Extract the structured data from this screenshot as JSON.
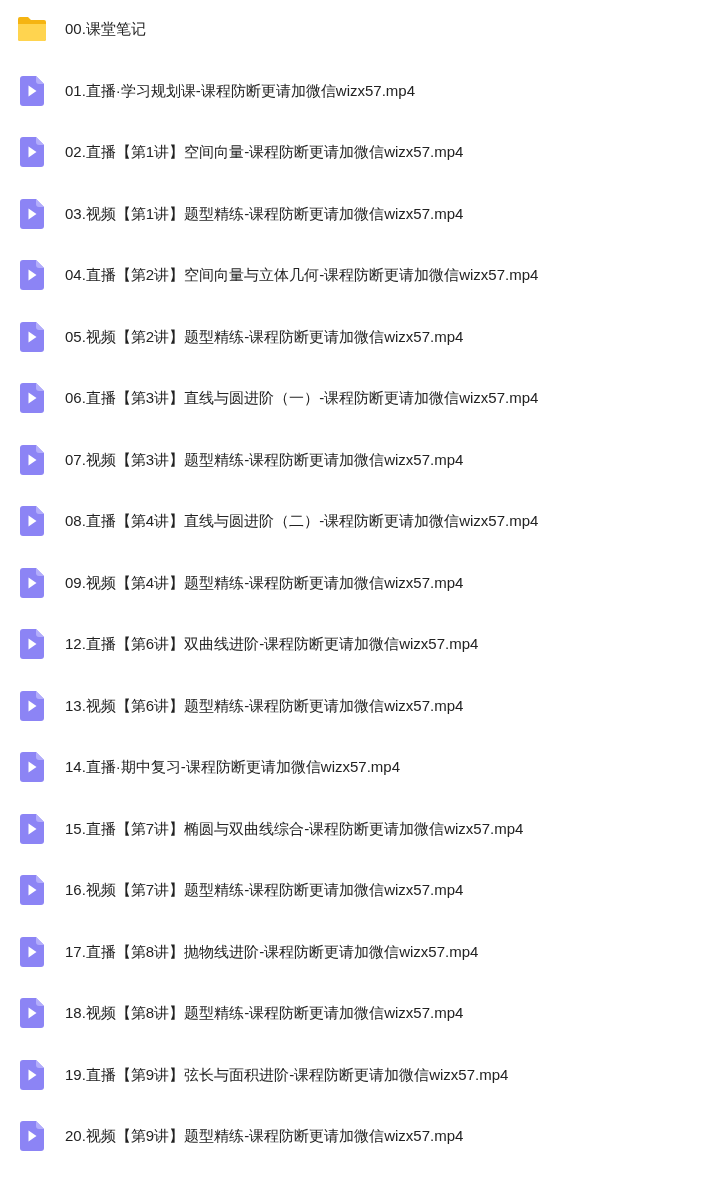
{
  "files": [
    {
      "kind": "folder",
      "name": "00.课堂笔记"
    },
    {
      "kind": "video",
      "name": "01.直播·学习规划课-课程防断更请加微信wizx57.mp4"
    },
    {
      "kind": "video",
      "name": "02.直播【第1讲】空间向量-课程防断更请加微信wizx57.mp4"
    },
    {
      "kind": "video",
      "name": "03.视频【第1讲】题型精练-课程防断更请加微信wizx57.mp4"
    },
    {
      "kind": "video",
      "name": "04.直播【第2讲】空间向量与立体几何-课程防断更请加微信wizx57.mp4"
    },
    {
      "kind": "video",
      "name": "05.视频【第2讲】题型精练-课程防断更请加微信wizx57.mp4"
    },
    {
      "kind": "video",
      "name": "06.直播【第3讲】直线与圆进阶（一）-课程防断更请加微信wizx57.mp4"
    },
    {
      "kind": "video",
      "name": "07.视频【第3讲】题型精练-课程防断更请加微信wizx57.mp4"
    },
    {
      "kind": "video",
      "name": "08.直播【第4讲】直线与圆进阶（二）-课程防断更请加微信wizx57.mp4"
    },
    {
      "kind": "video",
      "name": "09.视频【第4讲】题型精练-课程防断更请加微信wizx57.mp4"
    },
    {
      "kind": "video",
      "name": "12.直播【第6讲】双曲线进阶-课程防断更请加微信wizx57.mp4"
    },
    {
      "kind": "video",
      "name": "13.视频【第6讲】题型精练-课程防断更请加微信wizx57.mp4"
    },
    {
      "kind": "video",
      "name": "14.直播·期中复习-课程防断更请加微信wizx57.mp4"
    },
    {
      "kind": "video",
      "name": "15.直播【第7讲】椭圆与双曲线综合-课程防断更请加微信wizx57.mp4"
    },
    {
      "kind": "video",
      "name": "16.视频【第7讲】题型精练-课程防断更请加微信wizx57.mp4"
    },
    {
      "kind": "video",
      "name": "17.直播【第8讲】抛物线进阶-课程防断更请加微信wizx57.mp4"
    },
    {
      "kind": "video",
      "name": "18.视频【第8讲】题型精练-课程防断更请加微信wizx57.mp4"
    },
    {
      "kind": "video",
      "name": "19.直播【第9讲】弦长与面积进阶-课程防断更请加微信wizx57.mp4"
    },
    {
      "kind": "video",
      "name": "20.视频【第9讲】题型精练-课程防断更请加微信wizx57.mp4"
    }
  ]
}
